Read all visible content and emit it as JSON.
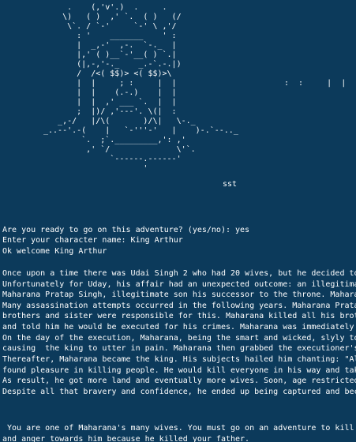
{
  "ascii_art": {
    "figure": "     .    (,'v'.)  .     .\n    \\)   ( )  ,' `.  ( )   (/\n     \\`. / `-'     `-' \\ ,'/\n       : '    _______    ' :\n       |  _,-'  ,-.  `-._  |\n       |,' ( )__`-'__( ) `.|\n       (|,-,'-._    _.-`.-.|)\n       /  /<( $$)> <( $$)>\\\n       |  |     ; :     |  |\n       |  |    (.-.)    |  |\n       |  |  ,' ___ `.  |  |\n       ;  |)/ ,'---'. \\(|  :\n   _,-/   |/\\(       )/\\|   \\-._\n_..--'.-(    |   `-'''-'   |    )-.`--.._\n        `.  ;`._________,': ,'\n         ,' `/              \\'`.\n              `------.------'\n                     '",
    "side_mark": ":  :     |  |",
    "label": "sst"
  },
  "dialog": {
    "prompt_adventure": "Are you ready to go on this adventure? (yes/no): yes",
    "prompt_name": "Enter your character name: King Arthur",
    "welcome": "Ok welcome King Arthur"
  },
  "story": [
    "Once upon a time there was Udai Singh 2 who had 20 wives, but he decided to",
    "Unfortunately for Uday, his affair had an unexpected outcome: an illegitimat",
    "Maharana Pratap Singh, illegitimate son his successor to the throne. Maharan",
    "Many assassination attempts occurred in the following years. Maharana Pratap",
    "brothers and sister were responsible for this. Maharana killed all his broth",
    "and told him he would be executed for his crimes. Maharana was immediately i",
    "On the day of the execution, Maharana, being the smart and wicked, slyly too",
    "causing  the king to utter in pain. Maharana then grabbed the executioner's",
    "Thereafter, Maharana became the king. His subjects hailed him chanting: \"All",
    "found pleasure in killing people. He would kill everyone in his way and take",
    "As result, he got more land and eventually more wives. Soon, age restricted",
    "Despite all that bravery and confidence, he ended up being captured and beca"
  ],
  "mission": [
    " You are one of Maharana's many wives. You must go on an adventure to kill M",
    "and anger towards him because he killed your father."
  ]
}
